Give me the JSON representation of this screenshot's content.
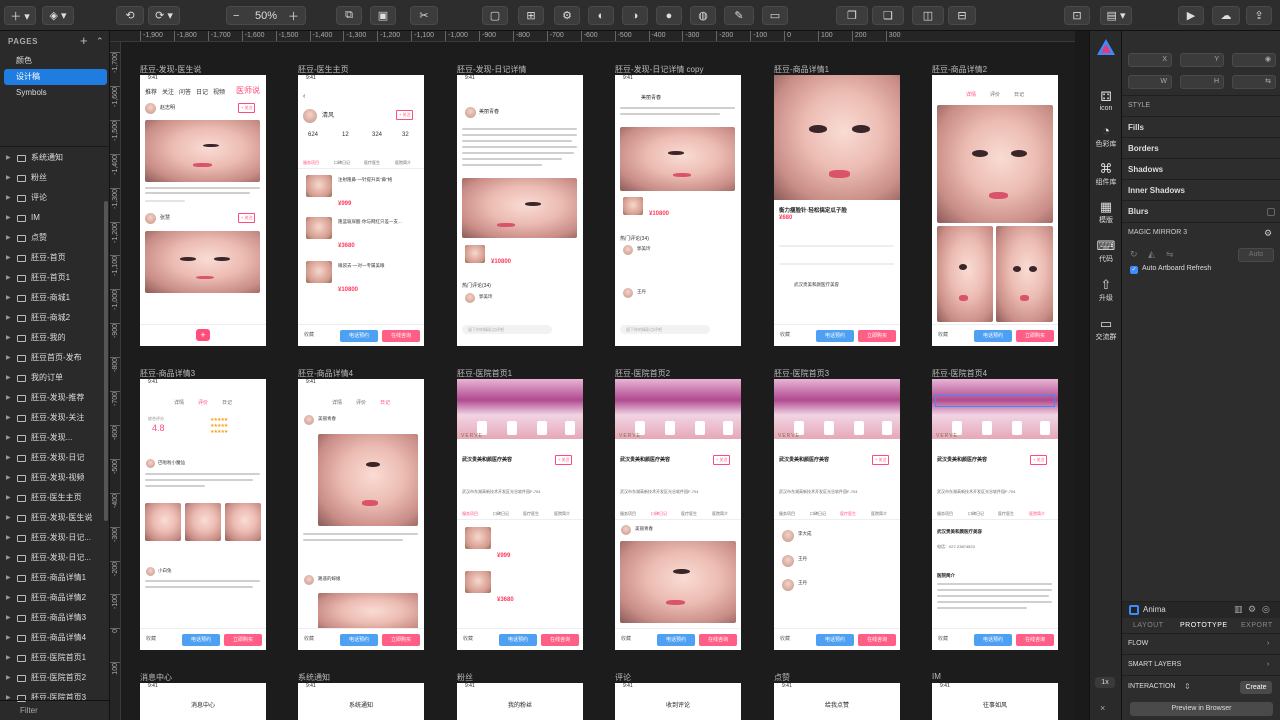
{
  "toolbar": {
    "zoom": "50%",
    "buttons": [
      "insert",
      "layers-group",
      "rotate",
      "flip",
      "zoom-out",
      "zoom-in",
      "resize",
      "scale",
      "scissors",
      "mask",
      "grid",
      "settings",
      "flatten",
      "union",
      "subtract",
      "intersect",
      "difference",
      "edit",
      "forward",
      "backward",
      "preview",
      "cloud",
      "export"
    ]
  },
  "sidebar": {
    "pages_title": "PAGES",
    "pages": [
      "颜色",
      "设计稿",
      "Symbols"
    ],
    "selected_page": "设计稿",
    "layers": [
      "系统通知",
      "粉丝",
      "评论",
      "IM",
      "点赞",
      "胚豆-首页",
      "胚豆-首页1",
      "胚豆-商城1",
      "胚豆-商城2",
      "胚豆-我的",
      "胚豆首页-发布",
      "我的订单",
      "胚豆-发现-推荐",
      "胚豆-发现-关注",
      "胚豆-发现...",
      "胚豆-发现-日记",
      "胚豆-发现-视频",
      "胚豆-医生主页",
      "胚豆-发现-医生说",
      "胚豆-发现-日记...",
      "胚豆-发现-日记...",
      "胚豆-商品详情1",
      "胚豆-商品详情2",
      "胚豆-商品详情3",
      "胚豆-商品详情4",
      "胚豆-医院首页1",
      "胚豆-医院首页2",
      "胚豆-医院首页3"
    ],
    "filter": "Filter"
  },
  "ruler": {
    "top": [
      "-1,900",
      "-1,800",
      "-1,700",
      "-1,600",
      "-1,500",
      "-1,400",
      "-1,300",
      "-1,200",
      "-1,100",
      "-1,000",
      "-900",
      "-800",
      "-700",
      "-600",
      "-500",
      "-400",
      "-300",
      "-200",
      "-100",
      "0",
      "100",
      "200",
      "300"
    ],
    "left": [
      "-1,700",
      "-1,600",
      "-1,500",
      "-1,400",
      "-1,300",
      "-1,200",
      "-1,100",
      "-1,000",
      "-900",
      "-800",
      "-700",
      "-600",
      "-500",
      "-400",
      "-300",
      "-200",
      "-100",
      "0",
      "100"
    ]
  },
  "artboards": {
    "row1": [
      "胚豆-发现-医生说",
      "胚豆-医生主页",
      "胚豆-发现-日记详情",
      "胚豆-发现-日记详情 copy",
      "胚豆-商品详情1",
      "胚豆-商品详情2"
    ],
    "row2": [
      "胚豆-商品详情3",
      "胚豆-商品详情4",
      "胚豆-医院首页1",
      "胚豆-医院首页2",
      "胚豆-医院首页3",
      "胚豆-医院首页4"
    ],
    "row3": [
      "消息中心",
      "系统通知",
      "粉丝",
      "评论",
      "点赞",
      "IM"
    ],
    "row3_titles": [
      "消息中心",
      "系统通知",
      "我的粉丝",
      "收到评论",
      "给我点赞",
      "往事如风"
    ]
  },
  "phone": {
    "time": "9:41",
    "btn_call": "电话预约",
    "btn_consult": "在线咨询",
    "btn_buy": "立即购买",
    "fav": "收藏",
    "follow": "+ 关注",
    "hospital": "武汉贵美和颜医疗美容",
    "address": "武汉市东湖高新技术开发区光谷软件园F-704",
    "product": "衡力瘦脸针·轻松搞定瓜子脸",
    "product_price": "¥680",
    "product_prices": [
      "¥999",
      "¥3680",
      "¥10800"
    ],
    "product_items": [
      "注射隆鼻·一针提升高\"鼻\"格",
      "隆蓝玻尿酸·你与网红只差一支...",
      "眼袋去·一对一专属美眼"
    ],
    "doctor1": "赵志明",
    "doctor2": "张慧",
    "doctor_name": "清风",
    "user1": "美丽青春",
    "user2": "路遥的嫁娘",
    "user3": "巴啦啦小魔仙",
    "user4": "小白兔",
    "user5": "郭美玲",
    "user6": "王丹",
    "user7": "李大成",
    "hot_comments": "热门评论(34)",
    "rating": "4.8",
    "rating_label": "综合评分",
    "tabs_home": [
      "推荐",
      "关注",
      "问答",
      "日记",
      "视频",
      "医师说"
    ],
    "tabs_detail": [
      "详情",
      "评价",
      "日记"
    ],
    "tabs_hosp": [
      "服务项目",
      "口碑日记",
      "医疗医生",
      "医院简介"
    ],
    "stats": [
      "624",
      "12",
      "324",
      "32"
    ],
    "stats_labels": [
      "粉丝",
      "关注",
      "获赞",
      "日记"
    ],
    "clinic_brand": "VERVE",
    "score": "5.0",
    "review_count": "234条点评",
    "intro_title": "医院简介",
    "intro_phone": "电话：027-23874523",
    "comment_placeholder": "留下你的精彩点评吧"
  },
  "iconcol": [
    "icon",
    "色彩库",
    "组件库",
    "模版",
    "代码",
    "升级",
    "交流群"
  ],
  "inspector": {
    "x_label": "X",
    "y_label": "Y",
    "w_label": "W",
    "h_label": "H",
    "sections": [
      "STYLE",
      "Fills",
      "Borders",
      "Shadows",
      "Inner Shadows",
      "Blurs"
    ],
    "magic_mirror": "MAGIC MIRROR 3",
    "auto_label": "Auto",
    "auto_refresh": "Auto Artboard Refresh",
    "anima": "Anima",
    "tabs": [
      "LAYOUT",
      "PROTOTYPE",
      "EXPORT"
    ],
    "active_tab": "PROTOTYPE",
    "flow": "FLOW",
    "smart_layers": "SMART LAYERS",
    "interaction": "INTERACTION",
    "zoom": "1x",
    "create": "Create",
    "preview": "Preview in Browser"
  }
}
